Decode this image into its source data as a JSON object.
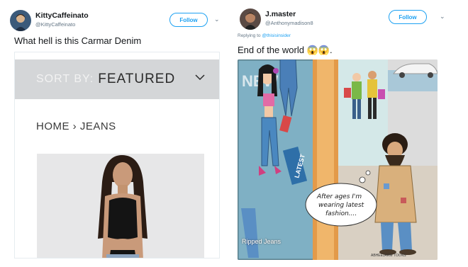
{
  "left_tweet": {
    "display_name": "KittyCaffeinato",
    "handle": "@KittyCaffeinato",
    "follow_label": "Follow",
    "text": "What hell is this Carmar Denim",
    "media": {
      "sort_label": "SORT BY:",
      "sort_value": "FEATURED",
      "breadcrumb": "HOME › JEANS"
    }
  },
  "right_tweet": {
    "display_name": "J.master",
    "handle": "@Anthonymadison8",
    "follow_label": "Follow",
    "reply_prefix": "Replying to",
    "reply_to": "@thisisinsider",
    "text": "End of the world",
    "emoji": "😱😱.",
    "media": {
      "bubble_line1": "After ages I'm",
      "bubble_line2": "wearing latest",
      "bubble_line3": "fashion....",
      "caption": "Ripped Jeans",
      "signage": "LATEST",
      "wall_text": "NEW",
      "signature": "ABHEEJARM TOONS"
    }
  },
  "colors": {
    "twitter_blue": "#1da1f2",
    "muted_text": "#657786",
    "sort_bar": "#d4d6d8"
  }
}
